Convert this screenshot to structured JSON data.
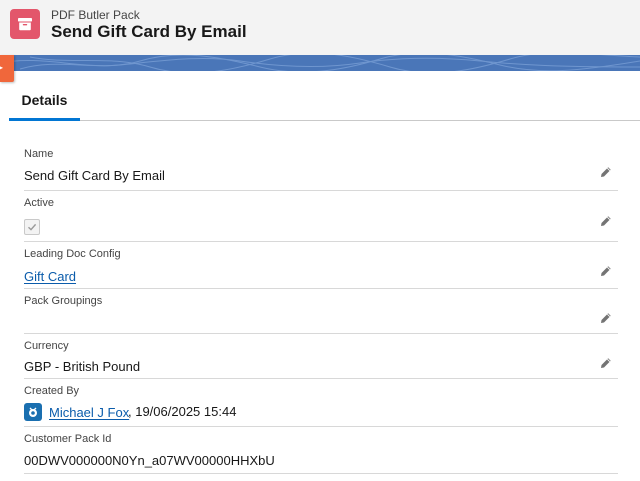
{
  "header": {
    "object_type": "PDF Butler Pack",
    "title": "Send Gift Card By Email",
    "icon": "archive-box-icon"
  },
  "tabs": [
    {
      "label": "Details",
      "active": true
    }
  ],
  "fields": {
    "name": {
      "label": "Name",
      "value": "Send Gift Card By Email"
    },
    "active": {
      "label": "Active",
      "checked": true
    },
    "leading_doc_config": {
      "label": "Leading Doc Config",
      "value": "Gift Card"
    },
    "pack_groupings": {
      "label": "Pack Groupings",
      "value": ""
    },
    "currency": {
      "label": "Currency",
      "value": "GBP - British Pound"
    },
    "created_by": {
      "label": "Created By",
      "user": "Michael J Fox",
      "date": ", 19/06/2025 15:44"
    },
    "customer_pack_id": {
      "label": "Customer Pack Id",
      "value": "00DWV000000N0Yn_a07WV00000HHXbU"
    }
  },
  "colors": {
    "accent": "#0176d3",
    "icon_bg": "#e3566b",
    "banner": "#4a76b8",
    "link": "#0b5cab"
  }
}
